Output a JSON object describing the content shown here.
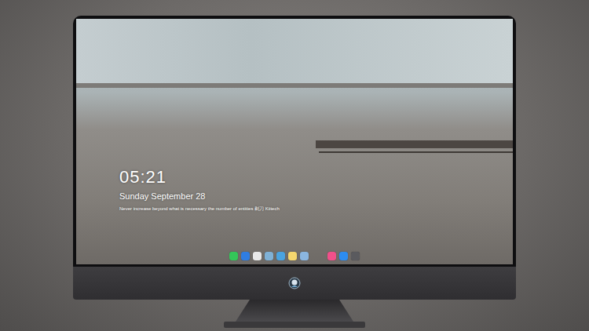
{
  "lock_screen": {
    "time": "05:21",
    "date": "Sunday September  28",
    "quote": "Never increase beyond what is necessary the number of entities 剃刀 Kiitech"
  },
  "dock": {
    "apps": [
      {
        "color": "#34c759"
      },
      {
        "color": "#2f7de1"
      },
      {
        "color": "#e8e8e8"
      },
      {
        "color": "#7fb1d6"
      },
      {
        "color": "#4aa3df"
      },
      {
        "color": "#f5d76e"
      },
      {
        "color": "#8bb6e0"
      }
    ],
    "extras": [
      {
        "color": "#f0508a"
      },
      {
        "color": "#2d8cf0"
      },
      {
        "color": "#5a5a5e"
      }
    ]
  }
}
